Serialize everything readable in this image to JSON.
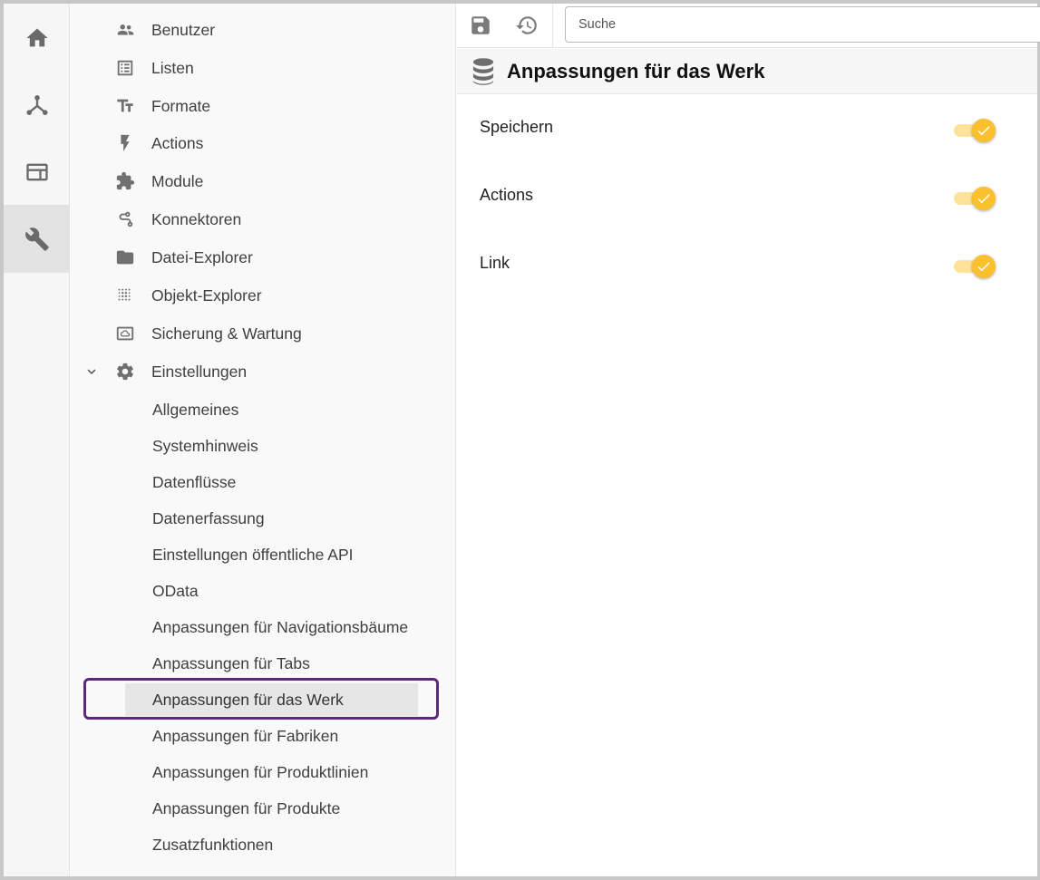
{
  "rail": {
    "items": [
      {
        "icon": "home-icon"
      },
      {
        "icon": "hierarchy-icon"
      },
      {
        "icon": "window-icon"
      },
      {
        "icon": "wrench-icon",
        "active": true
      }
    ]
  },
  "nav": {
    "items": [
      {
        "label": "Benutzer",
        "icon": "users-icon"
      },
      {
        "label": "Listen",
        "icon": "list-icon"
      },
      {
        "label": "Formate",
        "icon": "text-format-icon"
      },
      {
        "label": "Actions",
        "icon": "lightning-icon"
      },
      {
        "label": "Module",
        "icon": "puzzle-icon"
      },
      {
        "label": "Konnektoren",
        "icon": "route-icon"
      },
      {
        "label": "Datei-Explorer",
        "icon": "folder-icon"
      },
      {
        "label": "Objekt-Explorer",
        "icon": "dots-grid-icon"
      },
      {
        "label": "Sicherung & Wartung",
        "icon": "backup-icon"
      },
      {
        "label": "Einstellungen",
        "icon": "gear-icon"
      }
    ],
    "settings_sub": [
      "Allgemeines",
      "Systemhinweis",
      "Datenflüsse",
      "Datenerfassung",
      "Einstellungen öffentliche API",
      "OData",
      "Anpassungen für Navigationsbäume",
      "Anpassungen für Tabs",
      "Anpassungen für das Werk",
      "Anpassungen für Fabriken",
      "Anpassungen für Produktlinien",
      "Anpassungen für Produkte",
      "Zusatzfunktionen"
    ],
    "selected": "Anpassungen für das Werk"
  },
  "toolbar": {
    "save_icon": "save-icon",
    "restore_icon": "restore-icon",
    "search_placeholder": "Suche"
  },
  "page": {
    "title": "Anpassungen für das Werk",
    "icon": "database-icon"
  },
  "settings": [
    {
      "label": "Speichern",
      "enabled": true
    },
    {
      "label": "Actions",
      "enabled": true
    },
    {
      "label": "Link",
      "enabled": true
    }
  ],
  "colors": {
    "accent": "#fbc02d",
    "accent_track": "#fde39a",
    "focus_ring": "#5c2a7c"
  }
}
